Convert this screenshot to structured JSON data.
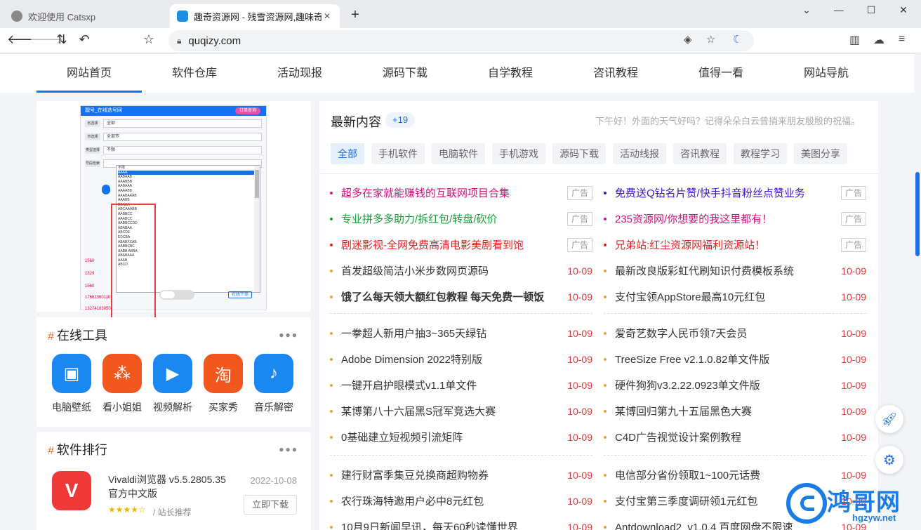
{
  "browser": {
    "tabs": [
      {
        "title": "欢迎使用 Catsxp"
      },
      {
        "title": "趣奇资源网 - 残雪资源网,趣味奇妙"
      }
    ],
    "url": "quqizy.com",
    "window_controls": {
      "minimize": "—",
      "maximize": "☐",
      "close": "✕",
      "expand": "⌄"
    }
  },
  "nav": {
    "items": [
      "网站首页",
      "软件仓库",
      "活动现报",
      "源码下载",
      "自学教程",
      "咨讯教程",
      "值得一看",
      "网站导航"
    ],
    "active_index": 0
  },
  "preview": {
    "header": "靓号_在线选号网",
    "header_button": "订单查询",
    "rows": [
      {
        "label": "省选择",
        "value": "全部"
      },
      {
        "label": "市选择",
        "value": "全部市"
      },
      {
        "label": "类型选择",
        "value": "不限"
      },
      {
        "label": "号段检索",
        "value": ""
      }
    ],
    "dropdown_options": [
      "不限",
      "AAAA",
      "AABAAB",
      "AAABBB",
      "AABAAA",
      "AAAABB",
      "AAABAAAB",
      "AAABB",
      "BBAAA",
      "ABCAAABB",
      "AABBCC",
      "AAABCC",
      "AABBCCDD",
      "ABABAA",
      "ABCDE",
      "EDCBA",
      "ABABXXAB",
      "AABBCBC",
      "AABB ABBA",
      "ABABAAA",
      "AAAB",
      "ABCD"
    ],
    "phones": [
      "1560",
      "1329",
      "1560",
      "17662360110",
      "13274183050"
    ],
    "query_btn": "在线下单"
  },
  "tools": {
    "title": "在线工具",
    "items": [
      {
        "label": "电脑壁纸",
        "icon": "image-icon",
        "color": "#1a88f0"
      },
      {
        "label": "看小姐姐",
        "icon": "grid-icon",
        "color": "#f2581e"
      },
      {
        "label": "视频解析",
        "icon": "play-icon",
        "color": "#1a88f0"
      },
      {
        "label": "买家秀",
        "icon": "tao-icon",
        "color": "#f2581e",
        "glyph": "淘"
      },
      {
        "label": "音乐解密",
        "icon": "music-icon",
        "color": "#1a88f0"
      }
    ]
  },
  "ranking": {
    "title": "软件排行",
    "item": {
      "name": "Vivaldi浏览器 v5.5.2805.35官方中文版",
      "date": "2022-10-08",
      "stars": "★★★★☆",
      "rec": "/ 站长推荐",
      "button": "立即下载"
    }
  },
  "latest": {
    "title": "最新内容",
    "count": "+19",
    "greeting": "下午好！外面的天气好吗？记得朵朵白云曾捎来朋友殷殷的祝福。",
    "categories": [
      "全部",
      "手机软件",
      "电脑软件",
      "手机游戏",
      "源码下载",
      "活动线报",
      "咨讯教程",
      "教程学习",
      "美图分享"
    ],
    "ad_label": "广告",
    "left": [
      {
        "text": "超多在家就能赚钱的互联网项目合集",
        "color": "#d1107b",
        "ad": true
      },
      {
        "text": "专业拼多多助力/拆红包/转盘/砍价",
        "color": "#1a9d3a",
        "ad": true
      },
      {
        "text": "剧迷影视-全网免费高清电影美剧看到饱",
        "color": "#e02020",
        "ad": true
      },
      {
        "text": "首发超级简洁小米步数网页源码",
        "date": "10-09"
      },
      {
        "text": "饿了么每天领大额红包教程 每天免费一顿饭",
        "date": "10-09",
        "bold": true
      },
      {
        "text": "一拳超人新用户抽3~365天绿钻",
        "date": "10-09"
      },
      {
        "text": "Adobe Dimension 2022特别版",
        "date": "10-09"
      },
      {
        "text": "一键开启护眼模式v1.1单文件",
        "date": "10-09"
      },
      {
        "text": "某博第八十六届黑S冠军竞选大赛",
        "date": "10-09"
      },
      {
        "text": "0基础建立短视频引流矩阵",
        "date": "10-09"
      },
      {
        "text": "建行财富季集豆兑换商超购物券",
        "date": "10-09"
      },
      {
        "text": "农行珠海特邀用户必中8元红包",
        "date": "10-09"
      },
      {
        "text": "10月9日新闻早讯，每天60秒读懂世界",
        "date": "10-09"
      }
    ],
    "right": [
      {
        "text": "免费送Q钻名片赞/快手抖音粉丝点赞业务",
        "color": "#3a12cf",
        "ad": true
      },
      {
        "text": "235资源网/你想要的我这里都有！",
        "color": "#d1107b",
        "ad": true
      },
      {
        "text": "兄弟站:红尘资源网福利资源站！",
        "color": "#e02020",
        "ad": true
      },
      {
        "text": "最新改良版彩虹代刷知识付费模板系统",
        "date": "10-09"
      },
      {
        "text": "支付宝领AppStore最高10元红包",
        "date": "10-09"
      },
      {
        "text": "爱奇艺数字人民币领7天会员",
        "date": "10-09"
      },
      {
        "text": "TreeSize Free v2.1.0.82单文件版",
        "date": "10-09"
      },
      {
        "text": "硬件狗狗v3.2.22.0923单文件版",
        "date": "10-09"
      },
      {
        "text": "某博回归第九十五届黑色大赛",
        "date": "10-09"
      },
      {
        "text": "C4D广告视觉设计案例教程",
        "date": "10-09"
      },
      {
        "text": "电信部分省份领取1~100元话费",
        "date": "10-09"
      },
      {
        "text": "支付宝第三季度调研领1元红包",
        "date": "10-09"
      },
      {
        "text": "Antdownload2_v1.0.4 百度网盘不限速",
        "date": "10-09"
      }
    ]
  },
  "watermark": {
    "title": "鸿哥网",
    "site": "hgzyw.net"
  }
}
